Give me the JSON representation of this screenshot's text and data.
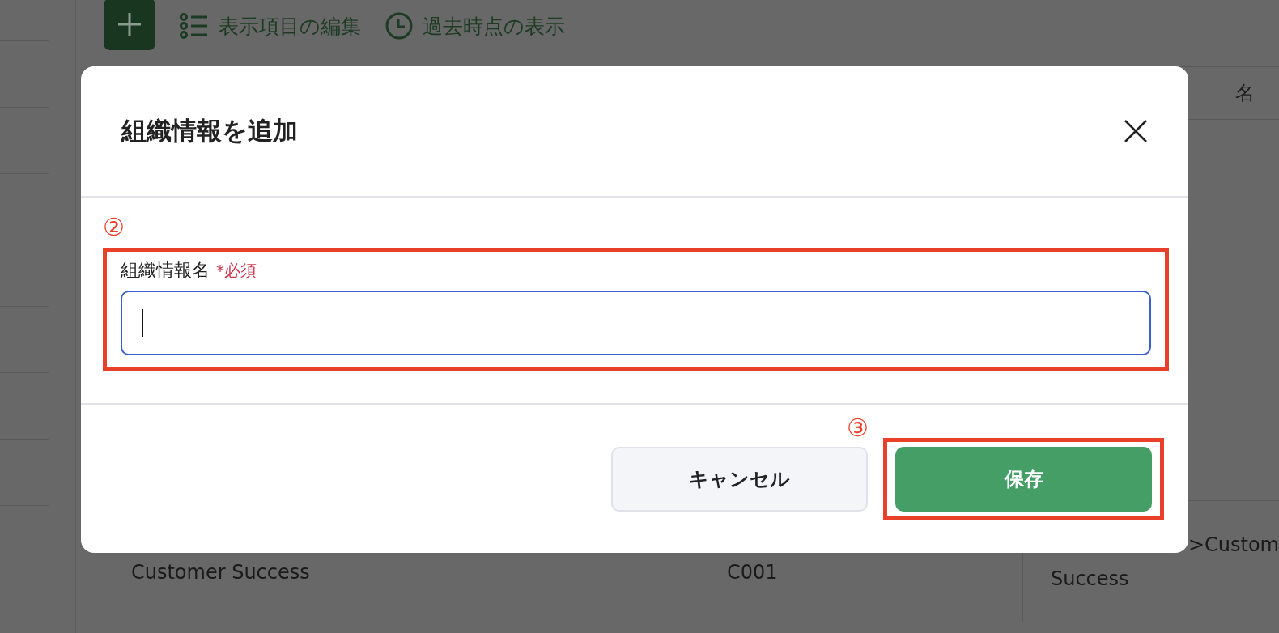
{
  "toolbar": {
    "items": [
      {
        "kind": "list",
        "label": "表示項目の編集"
      },
      {
        "kind": "clock",
        "label": "過去時点の表示"
      }
    ]
  },
  "table": {
    "column_3_header": "名",
    "rows": [
      {
        "column_1": "Customer Success",
        "column_2": "C001",
        "column_3": [
          ">Custom",
          "Success"
        ]
      }
    ]
  },
  "dialog": {
    "title": "組織情報を追加",
    "field": {
      "label": "組織情報名",
      "required_mark": "*必須",
      "focused": true,
      "annotation": "②"
    },
    "buttons": [
      {
        "kind": "secondary",
        "label": "キャンセル"
      },
      {
        "kind": "primary",
        "label": "保存",
        "annotation": "③"
      }
    ]
  }
}
